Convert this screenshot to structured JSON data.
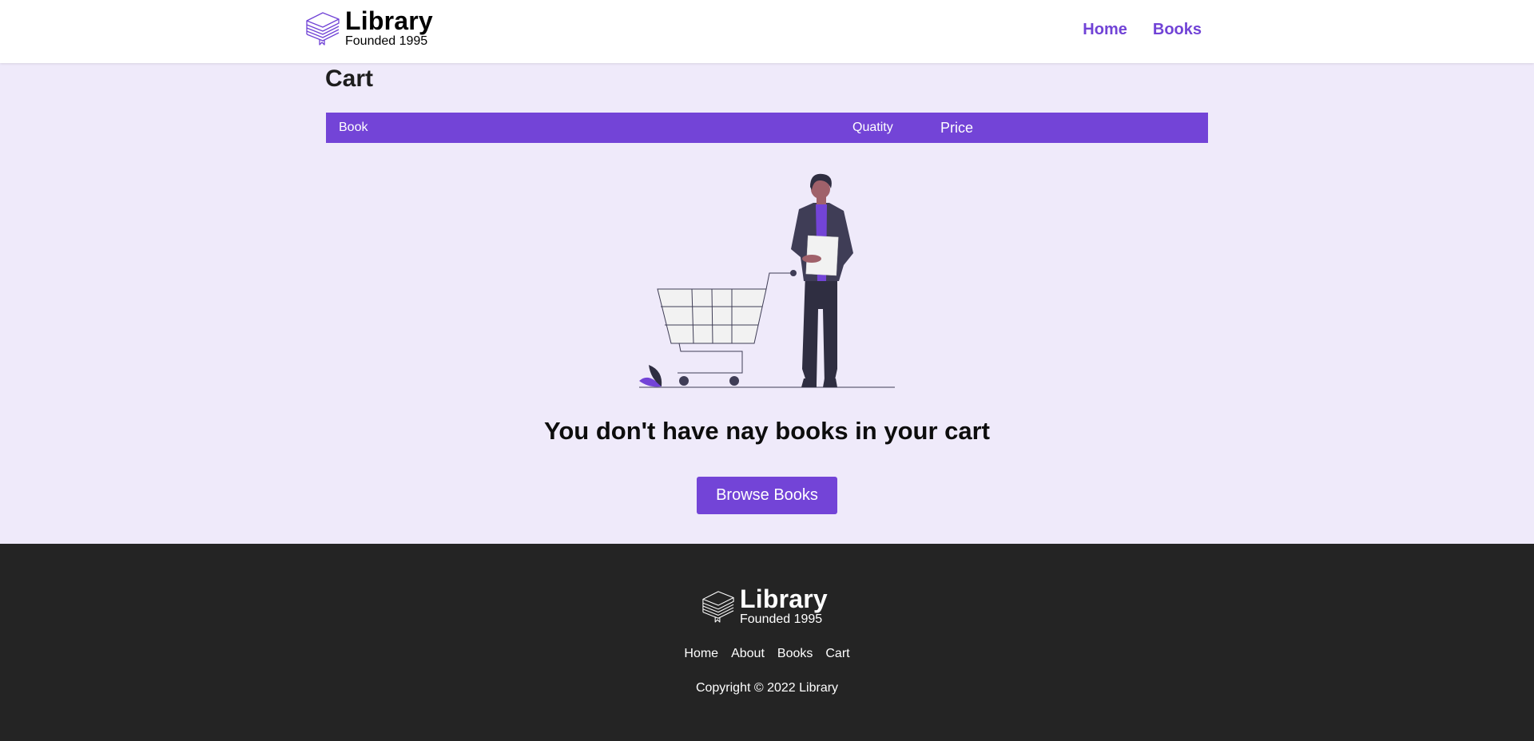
{
  "header": {
    "brand_name": "Library",
    "brand_tagline": "Founded 1995",
    "nav": [
      {
        "label": "Home"
      },
      {
        "label": "Books"
      }
    ]
  },
  "cart": {
    "title": "Cart",
    "columns": {
      "book": "Book",
      "quantity": "Quatity",
      "price": "Price"
    },
    "empty_message": "You don't have nay books in your cart",
    "browse_button": "Browse Books"
  },
  "footer": {
    "brand_name": "Library",
    "brand_tagline": "Founded 1995",
    "links": [
      {
        "label": "Home"
      },
      {
        "label": "About"
      },
      {
        "label": "Books"
      },
      {
        "label": "Cart"
      }
    ],
    "copyright": "Copyright © 2022 Library"
  },
  "colors": {
    "accent": "#7344d7",
    "page_background": "#efeafa",
    "footer_background": "#242424"
  }
}
